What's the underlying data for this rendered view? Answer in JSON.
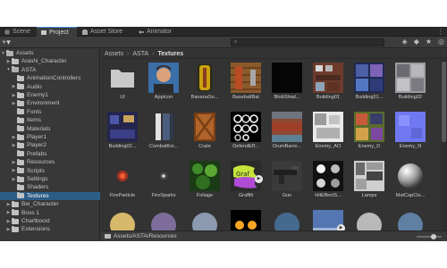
{
  "tabs": [
    {
      "label": "Scene",
      "icon": "hash-icon"
    },
    {
      "label": "Project",
      "icon": "folder-icon",
      "active": true
    },
    {
      "label": "Asset Store",
      "icon": "store-icon"
    },
    {
      "label": "Animator",
      "icon": "animator-icon"
    }
  ],
  "toolbar": {
    "add_label": "+▾",
    "search_placeholder": ""
  },
  "sidebar": {
    "items": [
      {
        "label": "Assets",
        "depth": 0,
        "expanded": true
      },
      {
        "label": "Arashi_Character",
        "depth": 1
      },
      {
        "label": "ASTA",
        "depth": 1,
        "expanded": true
      },
      {
        "label": "AnimationControllers",
        "depth": 2
      },
      {
        "label": "Audio",
        "depth": 2
      },
      {
        "label": "Enemy1",
        "depth": 2
      },
      {
        "label": "Environment",
        "depth": 2
      },
      {
        "label": "Fonts",
        "depth": 2
      },
      {
        "label": "Items",
        "depth": 2
      },
      {
        "label": "Materials",
        "depth": 2
      },
      {
        "label": "Player1",
        "depth": 2
      },
      {
        "label": "Player2",
        "depth": 2
      },
      {
        "label": "Prefabs",
        "depth": 2
      },
      {
        "label": "Resources",
        "depth": 2
      },
      {
        "label": "Scripts",
        "depth": 2
      },
      {
        "label": "Settings",
        "depth": 2
      },
      {
        "label": "Shaders",
        "depth": 2
      },
      {
        "label": "Textures",
        "depth": 2,
        "selected": true
      },
      {
        "label": "Bei_Character",
        "depth": 1
      },
      {
        "label": "Boss 1",
        "depth": 1
      },
      {
        "label": "Chartboost",
        "depth": 1
      },
      {
        "label": "Extensions",
        "depth": 1
      }
    ]
  },
  "breadcrumb": {
    "items": [
      "Assets",
      "ASTA",
      "Textures"
    ]
  },
  "assets": [
    {
      "label": "UI",
      "kind": "folder"
    },
    {
      "label": "AppIcon",
      "kind": "portrait"
    },
    {
      "label": "BananaSo...",
      "kind": "banana"
    },
    {
      "label": "BaseballBat",
      "kind": "bat"
    },
    {
      "label": "BlobShad...",
      "kind": "black"
    },
    {
      "label": "Building01",
      "kind": "building1"
    },
    {
      "label": "Building01...",
      "kind": "building2"
    },
    {
      "label": "Building02",
      "kind": "building3"
    },
    {
      "label": "Building02...",
      "kind": "building4"
    },
    {
      "label": "CombatKni...",
      "kind": "knife"
    },
    {
      "label": "Crate",
      "kind": "crate"
    },
    {
      "label": "DefendEff...",
      "kind": "rings"
    },
    {
      "label": "DrumBarre...",
      "kind": "barrel"
    },
    {
      "label": "Enemy_AO",
      "kind": "enemyao"
    },
    {
      "label": "Enemy_D",
      "kind": "enemyd"
    },
    {
      "label": "Enemy_N",
      "kind": "enemyn"
    },
    {
      "label": "FireParticle",
      "kind": "fire"
    },
    {
      "label": "FireSparks",
      "kind": "sparks"
    },
    {
      "label": "Foliage",
      "kind": "foliage"
    },
    {
      "label": "Graffiti",
      "kind": "graffiti"
    },
    {
      "label": "Gun",
      "kind": "gun"
    },
    {
      "label": "HitEffectS...",
      "kind": "hitfx"
    },
    {
      "label": "Lamps",
      "kind": "lamps"
    },
    {
      "label": "MatCapClo...",
      "kind": "matcap"
    },
    {
      "label": "",
      "kind": "sphere1"
    },
    {
      "label": "",
      "kind": "sphere2"
    },
    {
      "label": "",
      "kind": "sphere3"
    },
    {
      "label": "",
      "kind": "glow"
    },
    {
      "label": "",
      "kind": "sphere4"
    },
    {
      "label": "",
      "kind": "sky"
    },
    {
      "label": "",
      "kind": "sphere5"
    },
    {
      "label": "",
      "kind": "sphere6"
    }
  ],
  "status": {
    "path": "Assets/ASTA/Resources"
  },
  "colors": {
    "selection": "#2c5d87",
    "panel": "#383838",
    "accent": "#4b90e2"
  }
}
